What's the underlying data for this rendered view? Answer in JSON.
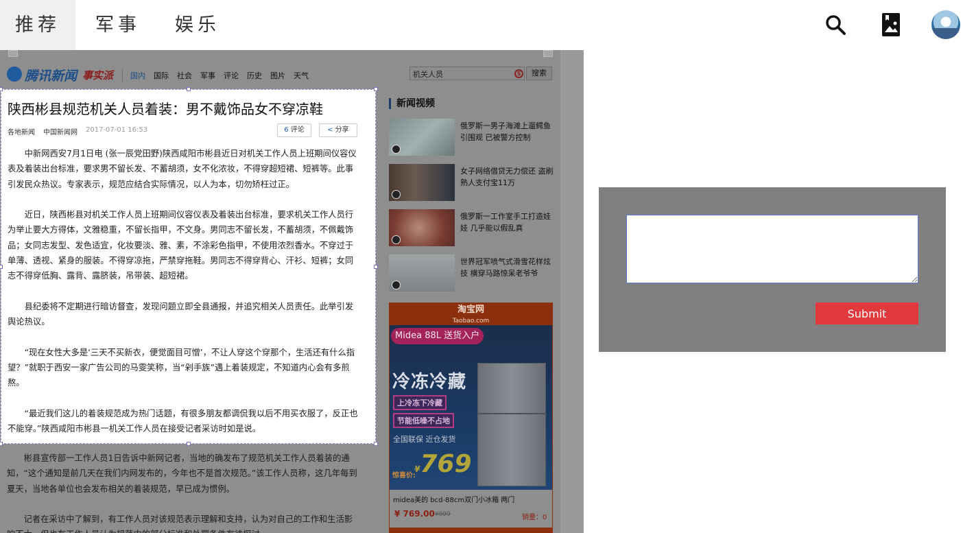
{
  "topbar": {
    "tabs": [
      {
        "label": "推荐",
        "active": true
      },
      {
        "label": "军事",
        "active": false
      },
      {
        "label": "娱乐",
        "active": false
      }
    ],
    "icons": [
      "search-icon",
      "bookmark-image-icon",
      "avatar"
    ]
  },
  "site": {
    "logo_text": "腾讯新闻",
    "logo_sub": "事实派",
    "nav": [
      "国内",
      "国际",
      "社会",
      "军事",
      "评论",
      "历史",
      "图片",
      "天气"
    ],
    "search_value": "机关人员",
    "search_button": "搜索"
  },
  "article": {
    "title": "陕西彬县规范机关人员着装：男不戴饰品女不穿凉鞋",
    "source1": "各地新闻",
    "source2": "中国新闻网",
    "date": "2017-07-01 16:53",
    "comment_count": "6",
    "comment_label": "评论",
    "share_label": "分享",
    "paragraphs": [
      "中新网西安7月1日电 (张一辰党田野)陕西咸阳市彬县近日对机关工作人员上班期间仪容仪表及着装出台标准，要求男不留长发、不蓄胡须，女不化浓妆，不得穿超短裙、短裤等。此事引发民众热议。专家表示，规范应结合实际情况，以人为本，切勿矫枉过正。",
      "近日，陕西彬县对机关工作人员上班期间仪容仪表及着装出台标准，要求机关工作人员行为举止要大方得体，文雅稳重，不留长指甲，不文身。男同志不留长发，不蓄胡须，不佩戴饰品；女同志发型、发色适宜，化妆要淡、雅、素，不涂彩色指甲，不使用浓烈香水。不穿过于单薄、透视、紧身的服装。不得穿凉拖，严禁穿拖鞋。男同志不得穿背心、汗衫、短裤；女同志不得穿低胸、露背、露脐装，吊带装、超短裙。",
      "县纪委将不定期进行暗访督查，发现问题立即全县通报，并追究相关人员责任。此举引发舆论热议。",
      "“现在女性大多是‘三天不买新衣，便觉面目可憎’，不让人穿这个穿那个，生活还有什么指望？”就职于西安一家广告公司的马雯笑称，当“剁手族”遇上着装规定，不知道内心会有多煎熬。",
      "“最近我们这儿的着装规范成为热门话题，有很多朋友都调侃我以后不用买衣服了，反正也不能穿。”陕西咸阳市彬县一机关工作人员在接受记者采访时如是说。"
    ],
    "more_paragraphs": [
      "彬县宣传部一工作人员1日告诉中新网记者，当地的确发布了规范机关工作人员着装的通知，“这个通知是前几天在我们内网发布的，今年也不是首次规范。”该工作人员称，这几年每到夏天，当地各单位也会发布相关的着装规范，早已成为惯例。",
      "记者在采访中了解到，有工作人员对该规范表示理解和支持，认为对自己的工作和生活影响不大。但也有工作人员认为规范中的部分标准和处罚条件有待探讨。"
    ]
  },
  "sidebar": {
    "title": "新闻视频",
    "videos": [
      {
        "caption": "俄罗斯一男子海滩上遛鳄鱼 引围观 已被警方控制"
      },
      {
        "caption": "女子网络借贷无力偿还 盗刷熟人支付宝11万"
      },
      {
        "caption": "俄罗斯一工作室手工打造娃娃 几乎能以假乱真"
      },
      {
        "caption": "世界冠军喷气式滑雪花样炫技 横穿马路惊呆老爷爷"
      }
    ]
  },
  "ad": {
    "site_name": "淘宝网",
    "site_domain": "Taobao.com",
    "brand": "Midea",
    "volume": "88L",
    "delivery": "送货入户",
    "headline": "冷冻冷藏",
    "tag1": "上冷冻下冷藏",
    "tag2": "节能低噪不占地",
    "features": "全国联保  近仓发货",
    "price_label": "惊喜价:",
    "price_big": "769",
    "product_name": "midea美的 bcd-88cm双门小冰箱 两门",
    "price": "¥ 769.00",
    "old_price": "¥999",
    "sales": "销量：0"
  },
  "form": {
    "textarea_value": "",
    "submit_label": "Submit"
  }
}
